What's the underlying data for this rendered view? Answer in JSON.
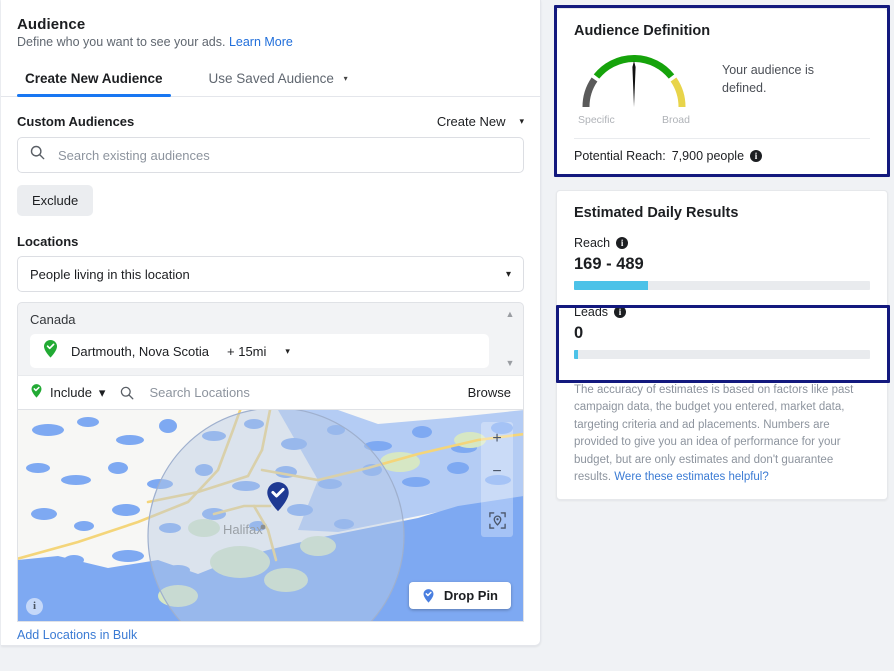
{
  "audience": {
    "title": "Audience",
    "subtitle": "Define who you want to see your ads.",
    "learn_more": "Learn More",
    "tabs": [
      {
        "label": "Create New Audience",
        "active": true
      },
      {
        "label": "Use Saved Audience",
        "active": false,
        "caret": "▾"
      }
    ]
  },
  "custom_audiences": {
    "label": "Custom Audiences",
    "create_new": "Create New",
    "create_new_caret": "▾",
    "search_placeholder": "Search existing audiences",
    "search_value": "",
    "exclude_button": "Exclude"
  },
  "locations": {
    "label": "Locations",
    "select_value": "People living in this location",
    "select_caret": "▾",
    "country": "Canada",
    "chips": [
      {
        "name": "Dartmouth, Nova Scotia",
        "radius": "+ 15mi",
        "caret": "▾",
        "pin_color": "#22aa34"
      }
    ],
    "scroll_up": "▲",
    "scroll_down": "▼",
    "include_label": "Include",
    "include_caret": "▾",
    "search_locations_placeholder": "Search Locations",
    "search_locations_value": "",
    "browse": "Browse",
    "add_bulk": "Add Locations in Bulk"
  },
  "map": {
    "city_label": "Halifax",
    "zoom_in": "+",
    "zoom_out": "−",
    "locate": "locate-icon",
    "drop_pin": "Drop Pin",
    "attribution": "i",
    "pin_color": "#1f3a93",
    "radius_circle_color": "#c8d4e8"
  },
  "audience_definition": {
    "title": "Audience Definition",
    "gauge": {
      "specific_label": "Specific",
      "broad_label": "Broad",
      "needle_position_percent": 50,
      "segment_colors": {
        "low": "#5a5a5a",
        "mid": "#16a30b",
        "high": "#e8d44a"
      }
    },
    "message": "Your audience is defined.",
    "potential_reach_label": "Potential Reach:",
    "potential_reach_value": "7,900 people"
  },
  "estimated_results": {
    "title": "Estimated Daily Results",
    "metrics": [
      {
        "name": "Reach",
        "value": "169 - 489",
        "bar_percent": 25
      },
      {
        "name": "Leads",
        "value": "0",
        "bar_percent": 1
      }
    ],
    "disclaimer": "The accuracy of estimates is based on factors like past campaign data, the budget you entered, market data, targeting criteria and ad placements. Numbers are provided to give you an idea of performance for your budget, but are only estimates and don't guarantee results.",
    "feedback_link": "Were these estimates helpful?"
  },
  "colors": {
    "accent_blue": "#1877f2",
    "bar_blue": "#4cc2e8",
    "highlight_navy": "#13197e",
    "link_blue": "#216fdb"
  }
}
